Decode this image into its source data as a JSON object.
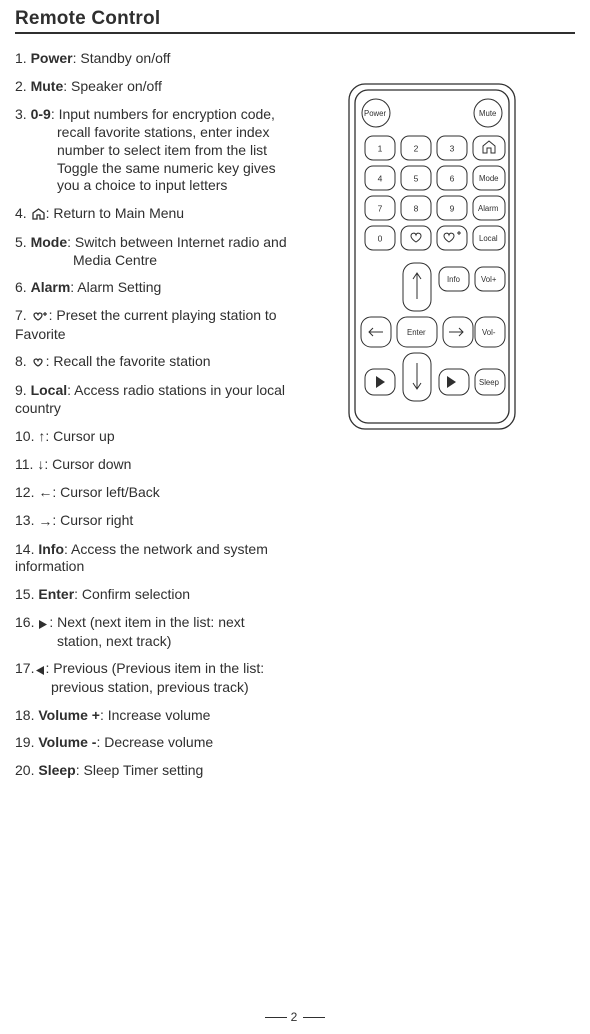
{
  "title": "Remote Control",
  "page_number": "2",
  "items": [
    {
      "n": "1. ",
      "b": "Power",
      "t": ": Standby on/off"
    },
    {
      "n": "2. ",
      "b": "Mute",
      "t": ": Speaker on/off"
    },
    {
      "n": "3. ",
      "b": "0-9",
      "t": ": Input numbers for encryption code,",
      "sub": [
        "recall favorite stations, enter index",
        "number to select item from the list",
        "Toggle the same numeric key gives",
        "you a choice to input letters"
      ]
    },
    {
      "n": "4. ",
      "icon": "home",
      "t": ": Return to Main Menu"
    },
    {
      "n": "5. ",
      "b": "Mode",
      "t": ": Switch between Internet radio and",
      "sub": [
        "Media Centre"
      ],
      "subindent": 58
    },
    {
      "n": "6. ",
      "b": "Alarm",
      "t": ": Alarm Setting"
    },
    {
      "n": "7. ",
      "icon": "fav-add",
      "t": ": Preset the current playing station to",
      "after": "Favorite"
    },
    {
      "n": "8. ",
      "icon": "fav",
      "t": ": Recall the favorite station"
    },
    {
      "n": "9. ",
      "b": "Local",
      "t": ": Access radio stations in your local",
      "after": "country"
    },
    {
      "n": "10. ",
      "icon": "up",
      "t": ": Cursor up"
    },
    {
      "n": "11. ",
      "icon": "down",
      "t": ": Cursor down"
    },
    {
      "n": "12. ",
      "icon": "left",
      "t": ": Cursor left/Back"
    },
    {
      "n": "13. ",
      "icon": "right",
      "t": ": Cursor right"
    },
    {
      "n": "14. ",
      "b": "Info",
      "t": ": Access the network and system",
      "after": "information"
    },
    {
      "n": "15. ",
      "b": "Enter",
      "t": ": Confirm selection"
    },
    {
      "n": "16. ",
      "icon": "next",
      "t": ": Next (next item in the list: next",
      "sub": [
        "station, next track)"
      ],
      "subindent": 42
    },
    {
      "n": "17.",
      "icon": "prev",
      "t": ": Previous (Previous item in the list:",
      "sub": [
        "previous station, previous track)"
      ],
      "subindent": 36
    },
    {
      "n": "18. ",
      "b": "Volume +",
      "t": ": Increase volume"
    },
    {
      "n": "19. ",
      "b": "Volume -",
      "t": ": Decrease volume"
    },
    {
      "n": "20. ",
      "b": "Sleep",
      "t": ": Sleep Timer setting"
    }
  ],
  "remote": {
    "labels": {
      "power": "Power",
      "mute": "Mute",
      "mode": "Mode",
      "alarm": "Alarm",
      "local": "Local",
      "info": "Info",
      "volp": "Vol+",
      "volm": "Vol-",
      "sleep": "Sleep",
      "enter": "Enter"
    },
    "nums": [
      "1",
      "2",
      "3",
      "4",
      "5",
      "6",
      "7",
      "8",
      "9",
      "0"
    ]
  }
}
